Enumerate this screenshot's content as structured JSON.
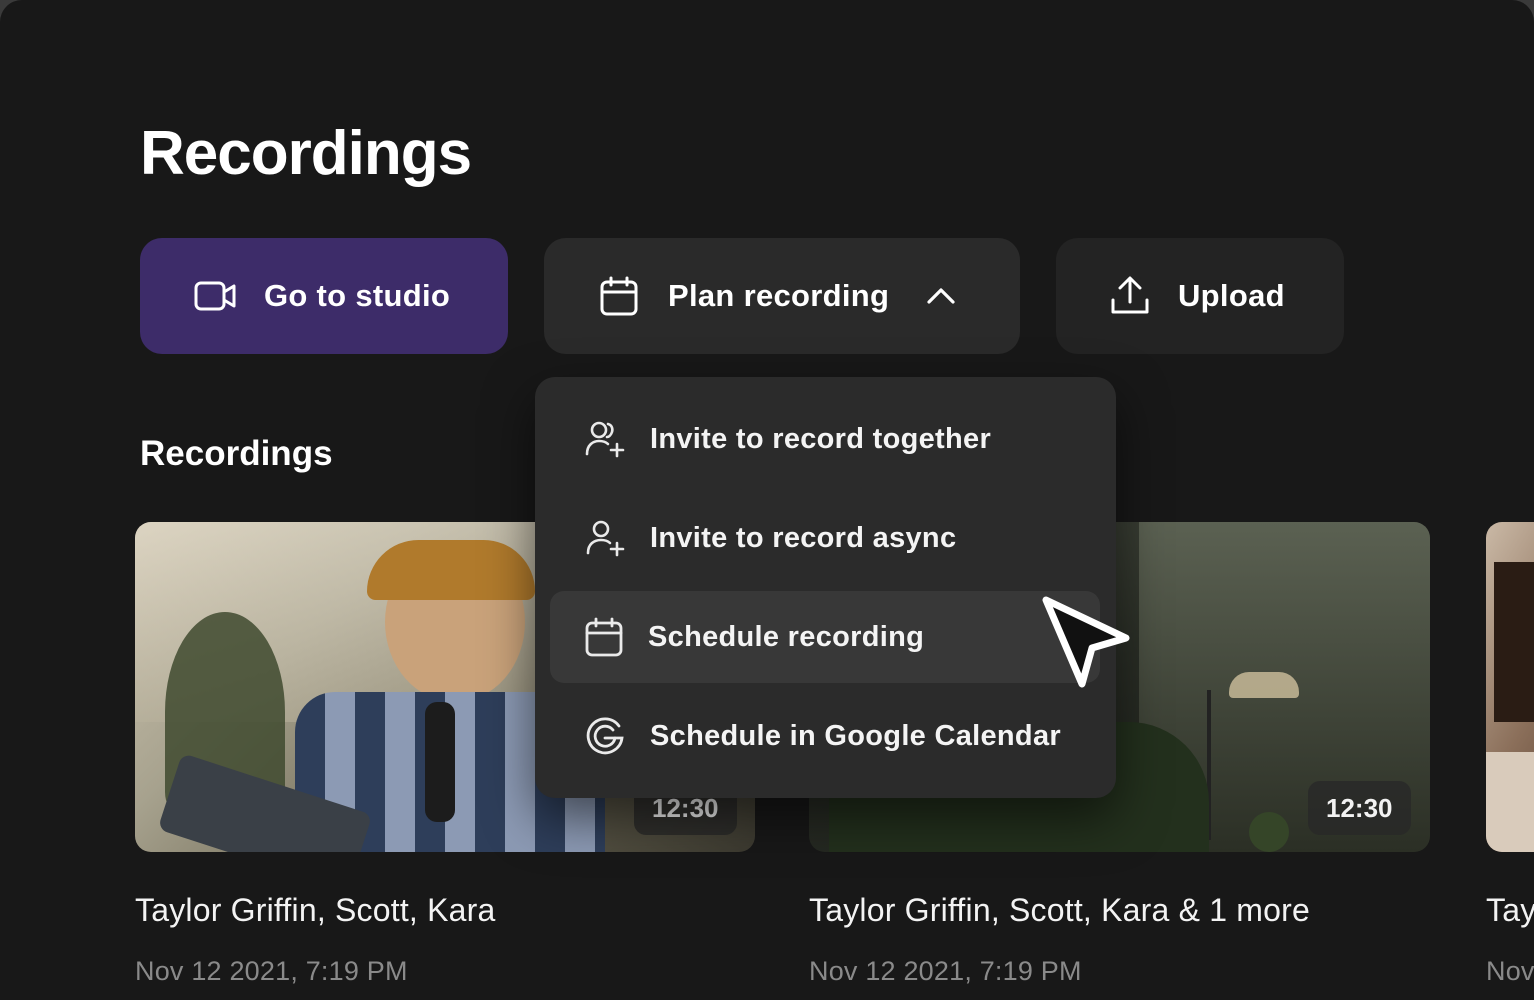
{
  "page": {
    "title": "Recordings"
  },
  "actions": {
    "studio": {
      "label": "Go to studio",
      "icon": "video-camera-icon"
    },
    "plan": {
      "label": "Plan recording",
      "icon": "calendar-icon",
      "state": "expanded"
    },
    "upload": {
      "label": "Upload",
      "icon": "upload-icon"
    }
  },
  "plan_menu": {
    "items": [
      {
        "label": "Invite to record together",
        "icon": "users-add-icon"
      },
      {
        "label": "Invite to record async",
        "icon": "user-add-icon"
      },
      {
        "label": "Schedule recording",
        "icon": "calendar-icon",
        "hovered": true
      },
      {
        "label": "Schedule in Google Calendar",
        "icon": "google-icon"
      }
    ]
  },
  "section": {
    "title": "Recordings"
  },
  "recordings": [
    {
      "duration": "12:30",
      "participants": "Taylor Griffin, Scott, Kara",
      "date": "Nov 12 2021, 7:19 PM"
    },
    {
      "duration": "12:30",
      "participants": "Taylor Griffin, Scott, Kara & 1 more",
      "date": "Nov 12 2021, 7:19 PM"
    },
    {
      "participants": "Tay",
      "date": "Nov"
    }
  ],
  "colors": {
    "background": "#181818",
    "accent": "#3d2c69",
    "surface": "#2a2a2a",
    "muted_text": "#8a8a8a"
  }
}
